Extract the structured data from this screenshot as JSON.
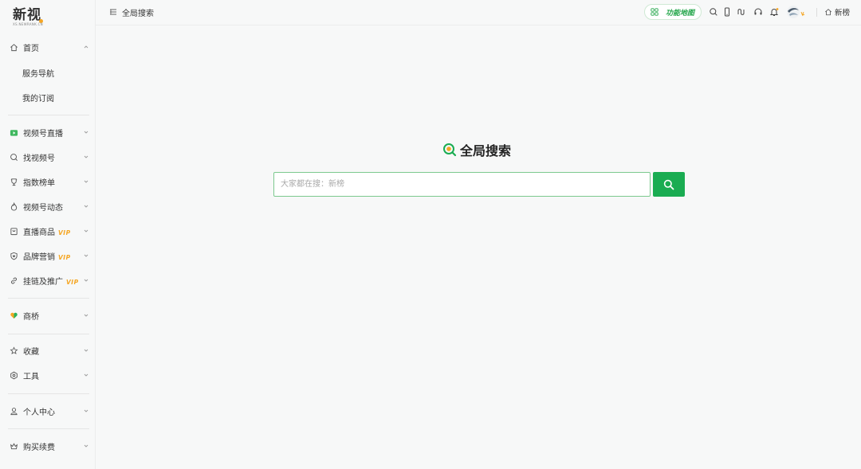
{
  "logo": {
    "main": "新视",
    "sub": "XS.NEWRANK.CN"
  },
  "breadcrumb": {
    "text": "全局搜索"
  },
  "topbar": {
    "function_map": "功能地图",
    "brand_link": "新榜"
  },
  "sidebar": {
    "home": "首页",
    "home_children": [
      "服务导航",
      "我的订阅"
    ],
    "items": [
      {
        "label": "视频号直播",
        "icon": "live-tv-icon",
        "vip": ""
      },
      {
        "label": "找视频号",
        "icon": "search-icon",
        "vip": ""
      },
      {
        "label": "指数榜单",
        "icon": "trophy-icon",
        "vip": ""
      },
      {
        "label": "视频号动态",
        "icon": "flame-icon",
        "vip": ""
      },
      {
        "label": "直播商品",
        "icon": "shop-icon",
        "vip": "VIP"
      },
      {
        "label": "品牌营销",
        "icon": "shield-heart-icon",
        "vip": "VIP"
      },
      {
        "label": "挂链及推广",
        "icon": "link-icon",
        "vip": "VIP"
      },
      {
        "label": "商桥",
        "icon": "heart-logo-icon",
        "vip": ""
      },
      {
        "label": "收藏",
        "icon": "star-icon",
        "vip": ""
      },
      {
        "label": "工具",
        "icon": "hex-tool-icon",
        "vip": ""
      },
      {
        "label": "个人中心",
        "icon": "user-icon",
        "vip": ""
      },
      {
        "label": "购买续费",
        "icon": "crown-icon",
        "vip": ""
      }
    ]
  },
  "main": {
    "title": "全局搜索",
    "search_placeholder": "大家都在搜：新榜",
    "search_value": ""
  },
  "colors": {
    "accent": "#1aac52",
    "vip": "#f5a623"
  }
}
